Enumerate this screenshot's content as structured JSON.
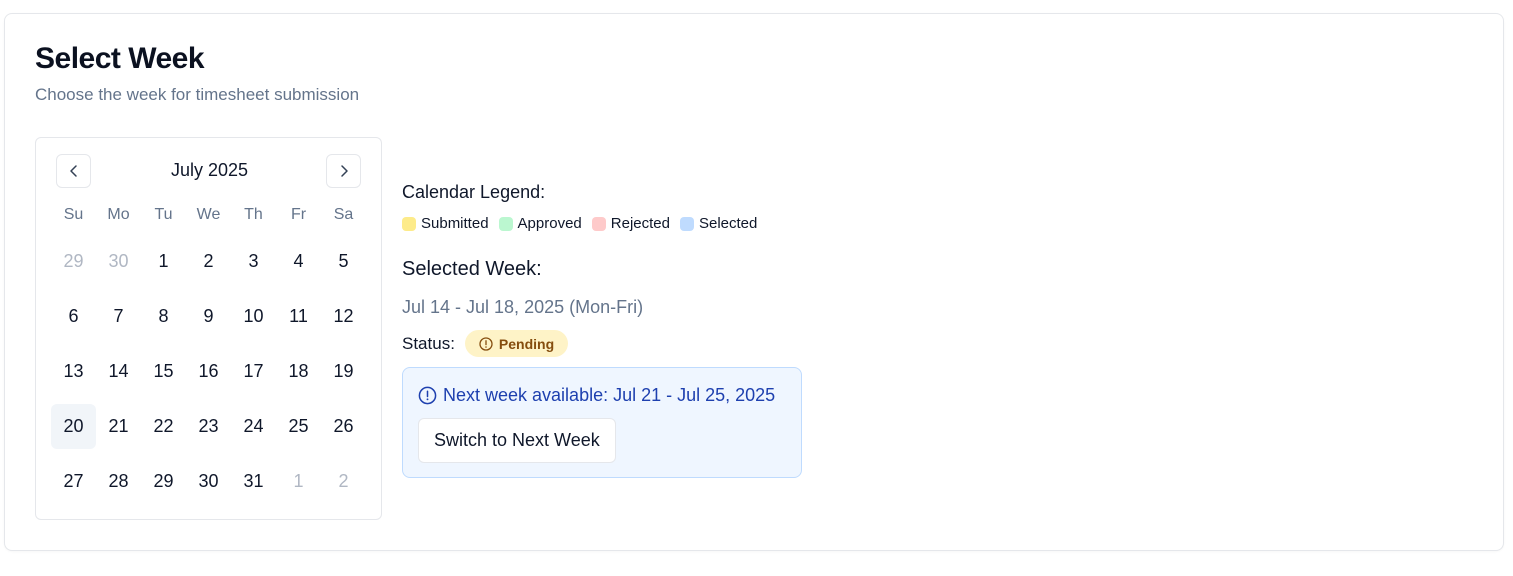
{
  "header": {
    "title": "Select Week",
    "subtitle": "Choose the week for timesheet submission"
  },
  "calendar": {
    "month_label": "July 2025",
    "weekdays": [
      "Su",
      "Mo",
      "Tu",
      "We",
      "Th",
      "Fr",
      "Sa"
    ],
    "weeks": [
      [
        {
          "d": "29",
          "outside": true
        },
        {
          "d": "30",
          "outside": true
        },
        {
          "d": "1"
        },
        {
          "d": "2"
        },
        {
          "d": "3"
        },
        {
          "d": "4"
        },
        {
          "d": "5"
        }
      ],
      [
        {
          "d": "6"
        },
        {
          "d": "7"
        },
        {
          "d": "8"
        },
        {
          "d": "9"
        },
        {
          "d": "10"
        },
        {
          "d": "11"
        },
        {
          "d": "12"
        }
      ],
      [
        {
          "d": "13"
        },
        {
          "d": "14"
        },
        {
          "d": "15"
        },
        {
          "d": "16"
        },
        {
          "d": "17"
        },
        {
          "d": "18"
        },
        {
          "d": "19"
        }
      ],
      [
        {
          "d": "20",
          "today": true
        },
        {
          "d": "21"
        },
        {
          "d": "22"
        },
        {
          "d": "23"
        },
        {
          "d": "24"
        },
        {
          "d": "25"
        },
        {
          "d": "26"
        }
      ],
      [
        {
          "d": "27"
        },
        {
          "d": "28"
        },
        {
          "d": "29"
        },
        {
          "d": "30"
        },
        {
          "d": "31"
        },
        {
          "d": "1",
          "outside": true
        },
        {
          "d": "2",
          "outside": true
        }
      ]
    ]
  },
  "legend": {
    "title": "Calendar Legend:",
    "items": [
      {
        "label": "Submitted",
        "color": "#fdeb8a"
      },
      {
        "label": "Approved",
        "color": "#bbf7d0"
      },
      {
        "label": "Rejected",
        "color": "#fecaca"
      },
      {
        "label": "Selected",
        "color": "#bfdbfe"
      }
    ]
  },
  "selected_week": {
    "title": "Selected Week:",
    "range": "Jul 14 - Jul 18, 2025 (Mon-Fri)",
    "status_label": "Status:",
    "status_value": "Pending"
  },
  "next_week": {
    "message": "Next week available: Jul 21 - Jul 25, 2025",
    "button_label": "Switch to Next Week"
  }
}
